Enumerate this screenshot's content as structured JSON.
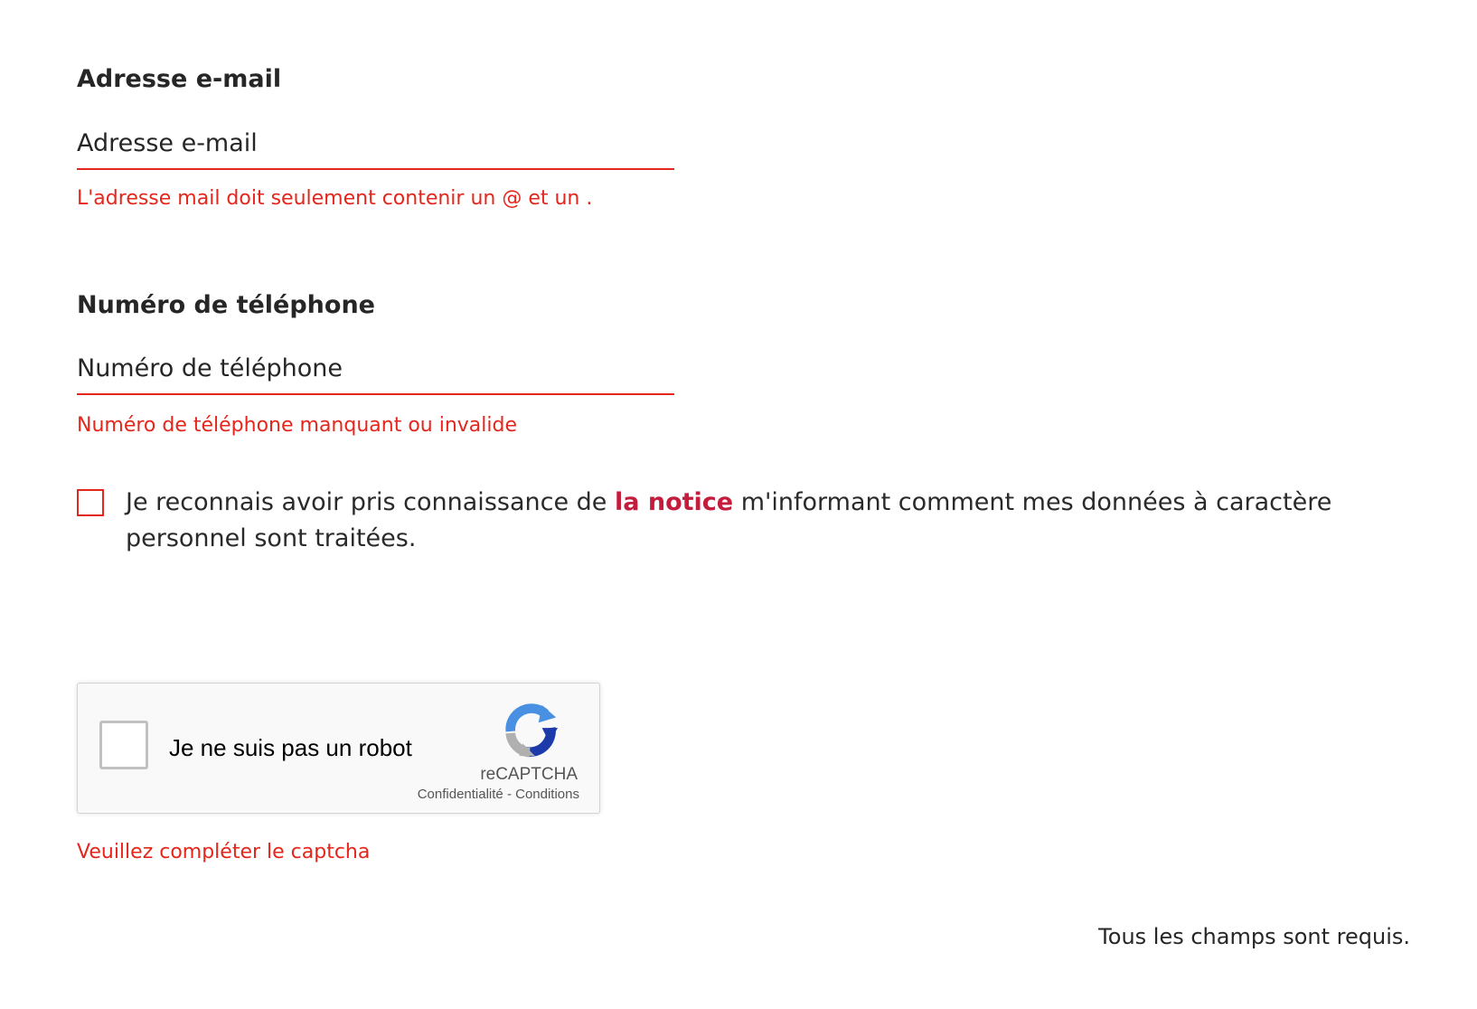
{
  "email": {
    "label": "Adresse e-mail",
    "placeholder": "Adresse e-mail",
    "value": "",
    "error": "L'adresse mail doit seulement contenir un @ et un ."
  },
  "phone": {
    "label": "Numéro de téléphone",
    "placeholder": "Numéro de téléphone",
    "value": "",
    "error": "Numéro de téléphone manquant ou invalide"
  },
  "consent": {
    "checked": false,
    "text_before": "Je reconnais avoir pris connaissance de ",
    "link_text": "la notice",
    "text_after": " m'informant comment mes données à caractère personnel sont traitées."
  },
  "recaptcha": {
    "label": "Je ne suis pas un robot",
    "brand": "reCAPTCHA",
    "privacy_link": "Confidentialité",
    "separator": "-",
    "terms_link": "Conditions",
    "icon": "recaptcha-logo-icon",
    "error": "Veuillez compléter le captcha"
  },
  "footer": {
    "required_note": "Tous les champs sont requis."
  },
  "colors": {
    "error": "#e4261c",
    "link": "#c41c3c",
    "text": "#262626"
  }
}
